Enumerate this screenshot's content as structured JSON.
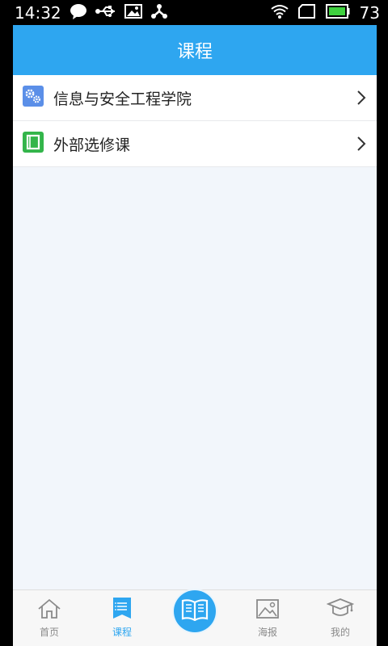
{
  "status_bar": {
    "time": "14:32",
    "battery": "73",
    "icons": [
      "chat-icon",
      "usb-icon",
      "image-icon",
      "share-icon",
      "wifi-icon",
      "sim-icon",
      "battery-icon"
    ]
  },
  "header": {
    "title": "课程"
  },
  "list": {
    "items": [
      {
        "label": "信息与安全工程学院",
        "icon": "gears-icon",
        "icon_color": "#5b8fe8"
      },
      {
        "label": "外部选修课",
        "icon": "book-icon",
        "icon_color": "#33b54a"
      }
    ]
  },
  "tabbar": {
    "tabs": [
      {
        "label": "首页",
        "icon": "home-icon",
        "active": false
      },
      {
        "label": "课程",
        "icon": "list-icon",
        "active": true
      },
      {
        "label": "",
        "icon": "open-book-icon",
        "active": false
      },
      {
        "label": "海报",
        "icon": "picture-icon",
        "active": false
      },
      {
        "label": "我的",
        "icon": "graduation-cap-icon",
        "active": false
      }
    ],
    "accent": "#2ea6f0"
  }
}
